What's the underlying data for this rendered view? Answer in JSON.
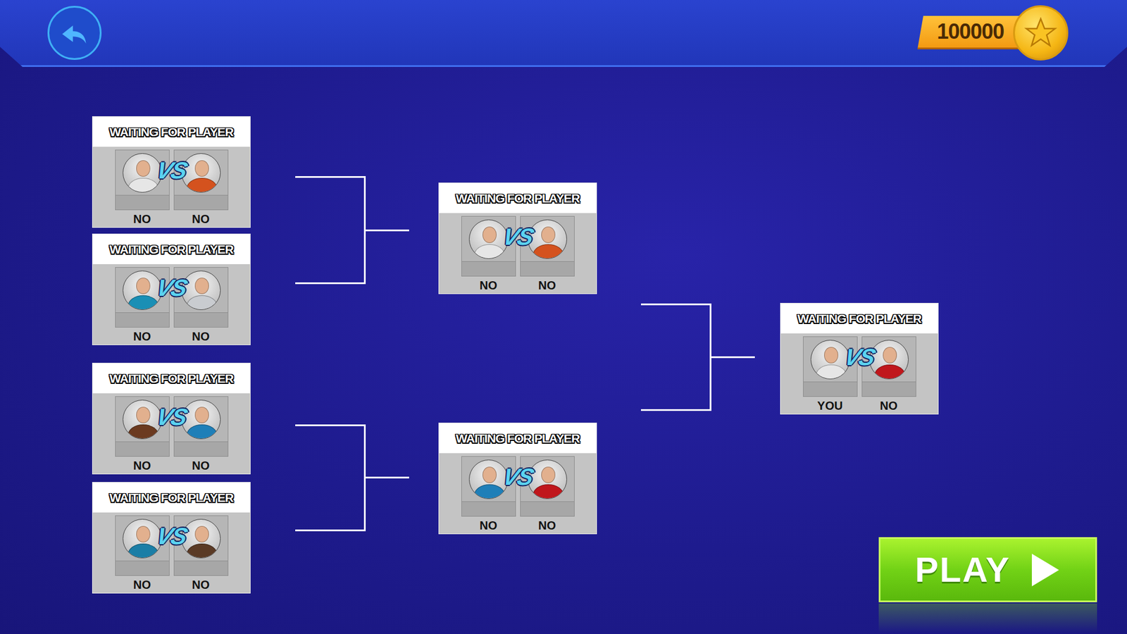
{
  "header": {
    "coins": "100000"
  },
  "bracket": {
    "rounds": [
      {
        "matches": [
          {
            "status": "WAITING FOR PLAYER",
            "vs": "VS",
            "players": [
              {
                "label": "NO",
                "color": "#e6e6e6"
              },
              {
                "label": "NO",
                "color": "#d4521e"
              }
            ]
          },
          {
            "status": "WAITING FOR PLAYER",
            "vs": "VS",
            "players": [
              {
                "label": "NO",
                "color": "#1a8fb5"
              },
              {
                "label": "NO",
                "color": "#c9ccd0"
              }
            ]
          },
          {
            "status": "WAITING FOR PLAYER",
            "vs": "VS",
            "players": [
              {
                "label": "NO",
                "color": "#6b3a20"
              },
              {
                "label": "NO",
                "color": "#1f7fb8"
              }
            ]
          },
          {
            "status": "WAITING FOR PLAYER",
            "vs": "VS",
            "players": [
              {
                "label": "NO",
                "color": "#1b7ea6"
              },
              {
                "label": "NO",
                "color": "#5a3a25"
              }
            ]
          }
        ]
      },
      {
        "matches": [
          {
            "status": "WAITING FOR PLAYER",
            "vs": "VS",
            "players": [
              {
                "label": "NO",
                "color": "#e6e6e6"
              },
              {
                "label": "NO",
                "color": "#d4521e"
              }
            ]
          },
          {
            "status": "WAITING FOR PLAYER",
            "vs": "VS",
            "players": [
              {
                "label": "NO",
                "color": "#1f7fb8"
              },
              {
                "label": "NO",
                "color": "#c0171c"
              }
            ]
          }
        ]
      },
      {
        "matches": [
          {
            "status": "WAITING FOR PLAYER",
            "vs": "VS",
            "players": [
              {
                "label": "YOU",
                "color": "#e6e6e6"
              },
              {
                "label": "NO",
                "color": "#c0171c"
              }
            ]
          }
        ]
      }
    ]
  },
  "play_button": {
    "label": "PLAY"
  }
}
